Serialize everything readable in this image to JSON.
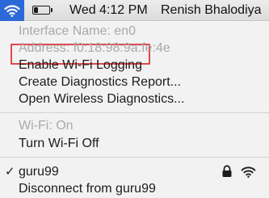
{
  "menubar": {
    "clock": "Wed 4:12 PM",
    "username": "Renish Bhalodiya",
    "icons": [
      "wifi-icon",
      "battery-icon"
    ],
    "battery_level": 0.3
  },
  "wifi_menu": {
    "interface_name": "Interface Name: en0",
    "address": "Address: f0:18:98:9a:fe:4e",
    "enable_logging": "Enable Wi-Fi Logging",
    "create_report": "Create Diagnostics Report...",
    "open_diagnostics": "Open Wireless Diagnostics...",
    "wifi_status": "Wi-Fi: On",
    "turn_off": "Turn Wi-Fi Off",
    "network_check": "✓",
    "network_name": "guru99",
    "disconnect": "Disconnect from guru99",
    "network_icons": [
      "lock-icon",
      "wifi-signal-icon"
    ]
  },
  "colors": {
    "highlight": "#e0474c",
    "menubar_selected": "#2d68d8",
    "disabled_text": "#a9a9a9"
  }
}
